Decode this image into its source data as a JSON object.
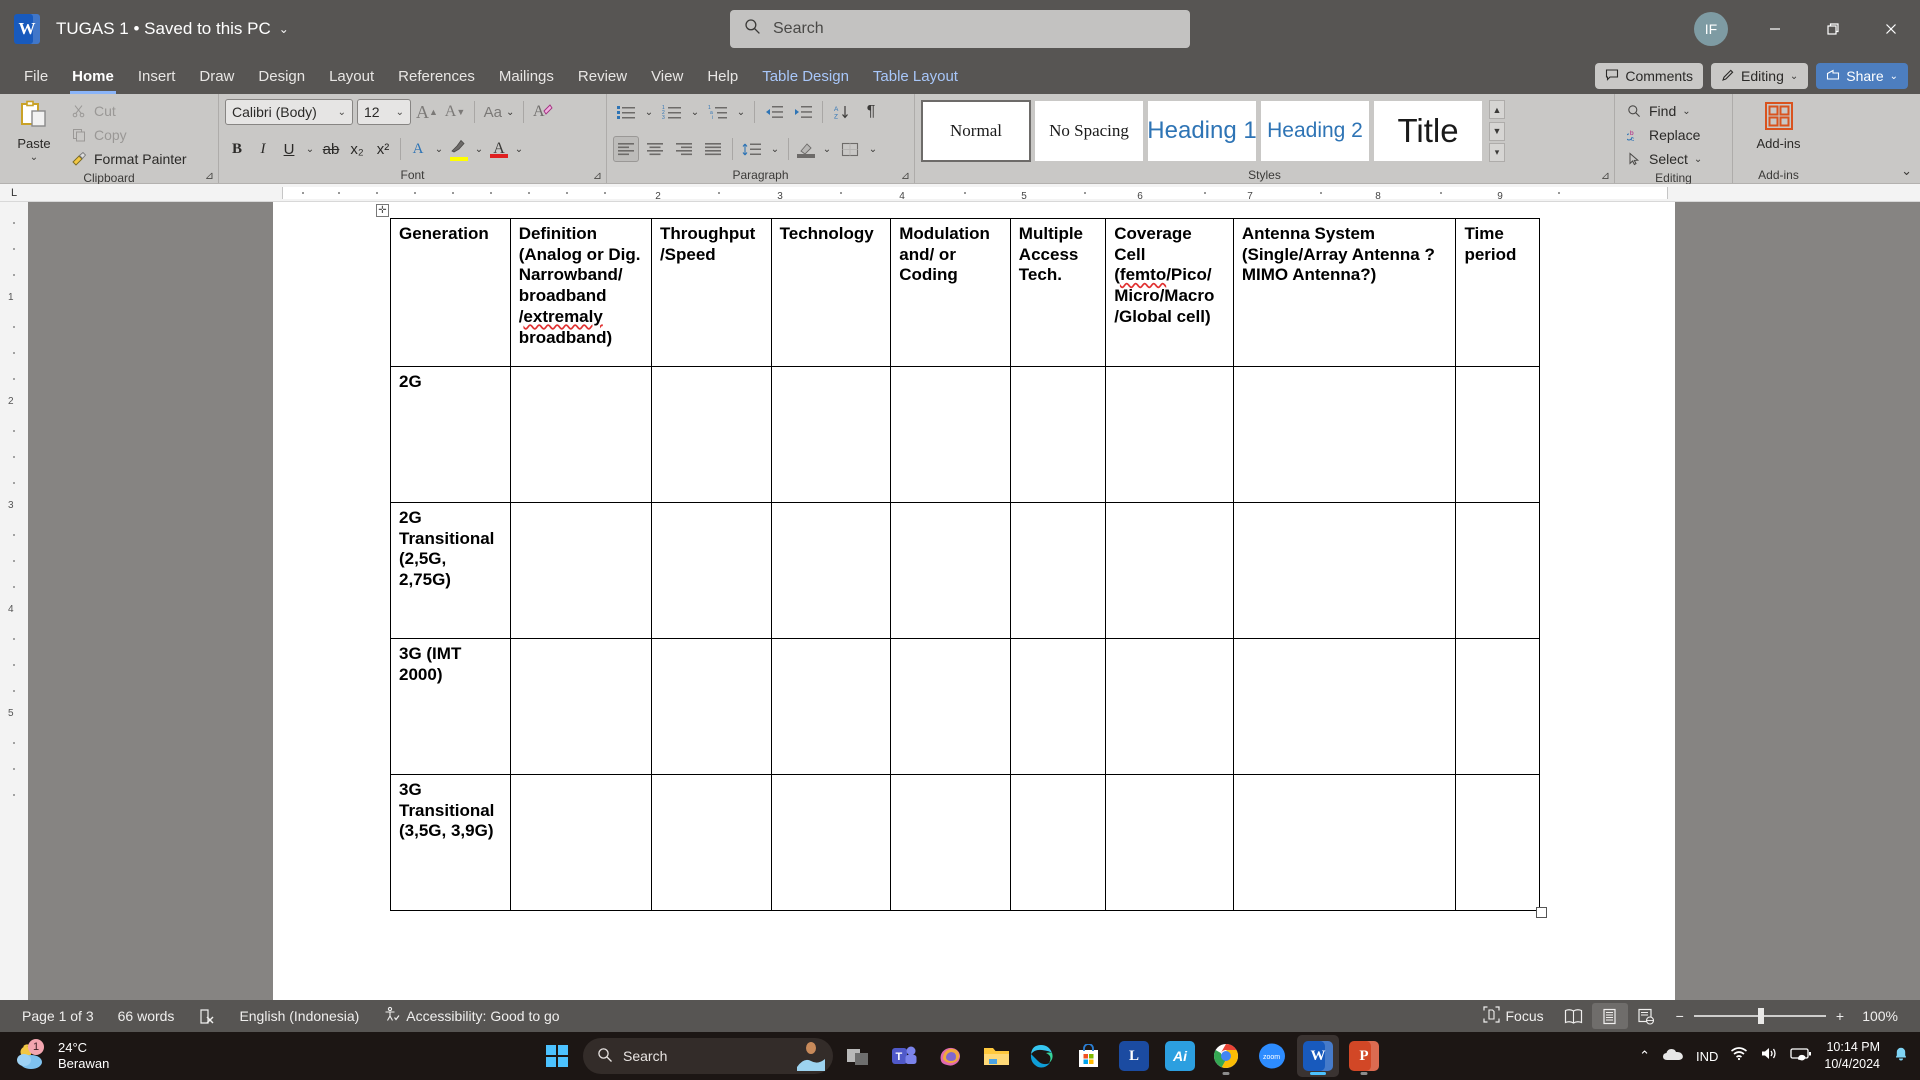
{
  "titlebar": {
    "app_icon": "word-logo-icon",
    "document_title": "TUGAS 1 • Saved to this PC",
    "title_chevron": "⌄",
    "search_placeholder": "Search",
    "search_value": "",
    "avatar_initials": "IF",
    "minimize_label": "Minimize",
    "restore_label": "Restore Down",
    "close_label": "Close"
  },
  "ribbon": {
    "tabs": [
      {
        "label": "File",
        "state": "normal"
      },
      {
        "label": "Home",
        "state": "active"
      },
      {
        "label": "Insert",
        "state": "normal"
      },
      {
        "label": "Draw",
        "state": "normal"
      },
      {
        "label": "Design",
        "state": "normal"
      },
      {
        "label": "Layout",
        "state": "normal"
      },
      {
        "label": "References",
        "state": "normal"
      },
      {
        "label": "Mailings",
        "state": "normal"
      },
      {
        "label": "Review",
        "state": "normal"
      },
      {
        "label": "View",
        "state": "normal"
      },
      {
        "label": "Help",
        "state": "normal"
      },
      {
        "label": "Table Design",
        "state": "contextual"
      },
      {
        "label": "Table Layout",
        "state": "contextual"
      }
    ],
    "comments_label": "Comments",
    "editing_label": "Editing",
    "share_label": "Share",
    "collapse_caret": "⌄",
    "clipboard": {
      "group_label": "Clipboard",
      "paste_label": "Paste",
      "paste_caret": "⌄",
      "cut_label": "Cut",
      "copy_label": "Copy",
      "format_painter_label": "Format Painter",
      "dialog_launcher": "⊿"
    },
    "font": {
      "group_label": "Font",
      "font_name": "Calibri (Body)",
      "font_size": "12",
      "grow_font": "A",
      "shrink_font": "A",
      "change_case": "Aa",
      "clear_formatting": "A",
      "bold": "B",
      "italic": "I",
      "underline": "U",
      "strikethrough": "ab",
      "subscript": "x₂",
      "superscript": "x²",
      "text_effects": "A",
      "highlight_color": "#ffff00",
      "font_color": "#e02020",
      "dialog_launcher": "⊿"
    },
    "paragraph": {
      "group_label": "Paragraph",
      "bullets": "bullets-icon",
      "numbering": "numbering-icon",
      "multilevel": "multilevel-list-icon",
      "decrease_indent": "decrease-indent-icon",
      "increase_indent": "increase-indent-icon",
      "sort": "sort-icon",
      "show_marks": "¶",
      "align_left": "align-left-icon",
      "align_center": "align-center-icon",
      "align_right": "align-right-icon",
      "justify": "justify-icon",
      "line_spacing": "line-spacing-icon",
      "shading": "shading-icon",
      "borders": "borders-icon",
      "dialog_launcher": "⊿"
    },
    "styles": {
      "group_label": "Styles",
      "items": [
        {
          "label": "Normal",
          "selected": true
        },
        {
          "label": "No Spacing",
          "selected": false
        },
        {
          "label": "Heading 1",
          "selected": false
        },
        {
          "label": "Heading 2",
          "selected": false
        },
        {
          "label": "Title",
          "selected": false
        }
      ],
      "scroll_up": "▲",
      "scroll_down": "▼",
      "more": "▾",
      "dialog_launcher": "⊿"
    },
    "editing": {
      "group_label": "Editing",
      "find_label": "Find",
      "find_caret": "⌄",
      "replace_label": "Replace",
      "select_label": "Select",
      "select_caret": "⌄"
    },
    "addins": {
      "group_label": "Add-ins",
      "button_label": "Add-ins"
    }
  },
  "ruler": {
    "corner_marker": "L",
    "ticks": [
      "1",
      "2",
      "3",
      "4",
      "5",
      "6",
      "7",
      "8",
      "9"
    ],
    "vertical_ticks": [
      "1",
      "2",
      "3",
      "4",
      "5"
    ]
  },
  "document": {
    "table": {
      "move_handle": "✛",
      "resize_handle": "resize-handle",
      "columns": [
        "Generation",
        "Definition (Analog or Dig. Narrowband/ broadband /extremaly broadband)",
        "Throughput /Speed",
        "Technology",
        "Modulation and/ or Coding",
        "Multiple Access Tech.",
        "Coverage Cell (femto/Pico/ Micro/Macro /Global cell)",
        "Antenna System (Single/Array Antenna ? MIMO Antenna?)",
        "Time period"
      ],
      "header_lines": [
        [
          "Generation"
        ],
        [
          "Definition",
          "(Analog or Dig.",
          "Narrowband/",
          "broadband",
          "/extremaly",
          "broadband)"
        ],
        [
          "Throughput",
          "/Speed"
        ],
        [
          "Technology"
        ],
        [
          "Modulation",
          "and/ or",
          "Coding"
        ],
        [
          "Multiple",
          "Access",
          "Tech."
        ],
        [
          "Coverage Cell",
          "(femto/Pico/",
          "Micro/Macro",
          "/Global cell)"
        ],
        [
          "Antenna System",
          "(Single/Array Antenna ?",
          "MIMO Antenna?)"
        ],
        [
          "Time",
          "period"
        ]
      ],
      "misspelled_words": [
        "extremaly",
        "femto"
      ],
      "rows": [
        {
          "generation_lines": [
            "2G"
          ],
          "cells": [
            "",
            "",
            "",
            "",
            "",
            "",
            "",
            ""
          ]
        },
        {
          "generation_lines": [
            "2G",
            "Transitional",
            "(2,5G,",
            "2,75G)"
          ],
          "cells": [
            "",
            "",
            "",
            "",
            "",
            "",
            "",
            ""
          ]
        },
        {
          "generation_lines": [
            "3G (IMT",
            "2000)"
          ],
          "cells": [
            "",
            "",
            "",
            "",
            "",
            "",
            "",
            ""
          ]
        },
        {
          "generation_lines": [
            "3G",
            "Transitional",
            "(3,5G, 3,9G)"
          ],
          "cells": [
            "",
            "",
            "",
            "",
            "",
            "",
            "",
            ""
          ]
        }
      ]
    }
  },
  "statusbar": {
    "page_info": "Page 1 of 3",
    "word_count": "66 words",
    "proofing_icon": "proofing-errors-icon",
    "language": "English (Indonesia)",
    "accessibility": "Accessibility: Good to go",
    "focus_label": "Focus",
    "view_read": "read-mode-icon",
    "view_print": "print-layout-icon",
    "view_web": "web-layout-icon",
    "zoom_out": "−",
    "zoom_in": "+",
    "zoom_level": "100%"
  },
  "taskbar": {
    "weather_temp": "24°C",
    "weather_desc": "Berawan",
    "weather_badge": "1",
    "start_label": "Start",
    "search_placeholder": "Search",
    "apps": [
      {
        "name": "task-view",
        "label": "",
        "color": "#8a8a8a"
      },
      {
        "name": "microsoft-teams",
        "label": "T",
        "color": "#5059c9"
      },
      {
        "name": "copilot",
        "label": "",
        "color": "#d96aa8"
      },
      {
        "name": "file-explorer",
        "label": "",
        "color": "#ffc83d"
      },
      {
        "name": "microsoft-edge",
        "label": "",
        "color": "#0f9ed8"
      },
      {
        "name": "microsoft-store",
        "label": "",
        "color": "#ffffff"
      },
      {
        "name": "line-app",
        "label": "L",
        "color": "#1b4ba1"
      },
      {
        "name": "adobe-illustrator",
        "label": "Ai",
        "color": "#2c9fe0"
      },
      {
        "name": "google-chrome",
        "label": "",
        "color": "#4285f4"
      },
      {
        "name": "zoom",
        "label": "zoom",
        "color": "#2d8cff"
      },
      {
        "name": "microsoft-word",
        "label": "W",
        "color": "#185abd"
      },
      {
        "name": "microsoft-powerpoint",
        "label": "P",
        "color": "#d24726"
      }
    ],
    "tray": {
      "overflow_caret": "⌃",
      "onedrive": "onedrive-icon",
      "language": "IND",
      "wifi": "wifi-icon",
      "volume": "volume-icon",
      "battery": "battery-icon",
      "time": "10:14 PM",
      "date": "10/4/2024",
      "notification": "notification-bell-icon"
    }
  }
}
